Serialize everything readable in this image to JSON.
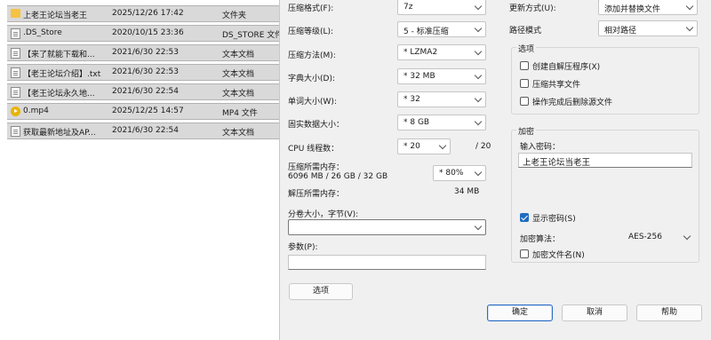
{
  "files": [
    {
      "icon": "folder-icon",
      "name": "上老王论坛当老王",
      "date": "2025/12/26 17:42",
      "type": "文件夹"
    },
    {
      "icon": "file-icon",
      "name": ".DS_Store",
      "date": "2020/10/15 23:36",
      "type": "DS_STORE 文件"
    },
    {
      "icon": "text-file-icon",
      "name": "【来了就能下载和...",
      "date": "2021/6/30 22:53",
      "type": "文本文档"
    },
    {
      "icon": "text-file-icon",
      "name": "【老王论坛介绍】.txt",
      "date": "2021/6/30 22:53",
      "type": "文本文档"
    },
    {
      "icon": "text-file-icon",
      "name": "【老王论坛永久地...",
      "date": "2021/6/30 22:54",
      "type": "文本文档"
    },
    {
      "icon": "media-file-icon",
      "name": "0.mp4",
      "date": "2025/12/25 14:57",
      "type": "MP4 文件"
    },
    {
      "icon": "text-file-icon",
      "name": "获取最新地址及AP...",
      "date": "2021/6/30 22:54",
      "type": "文本文档"
    }
  ],
  "left": {
    "format_label": "压缩格式(F):",
    "format_value": "7z",
    "level_label": "压缩等级(L):",
    "level_value": "5 - 标准压缩",
    "method_label": "压缩方法(M):",
    "method_value": "* LZMA2",
    "dict_label": "字典大小(D):",
    "dict_value": "* 32 MB",
    "word_label": "单词大小(W):",
    "word_value": "* 32",
    "solid_label": "固实数据大小：",
    "solid_value": "* 8 GB",
    "cpu_label": "CPU 线程数：",
    "cpu_value": "* 20",
    "cpu_max": "/ 20",
    "mem_label": "压缩所需内存：",
    "mem_detail": "6096 MB / 26 GB / 32 GB",
    "mem_percent": "* 80%",
    "decomp_label": "解压所需内存：",
    "decomp_value": "34 MB",
    "split_label": "分卷大小，字节(V):",
    "split_value": "",
    "params_label": "参数(P):",
    "params_value": "",
    "options_button": "选项"
  },
  "right": {
    "update_label": "更新方式(U):",
    "update_value": "添加并替换文件",
    "path_label": "路径模式",
    "path_value": "相对路径",
    "options_group": "选项",
    "opt_sfx": "创建自解压程序(X)",
    "opt_sfx_checked": false,
    "opt_shared": "压缩共享文件",
    "opt_shared_checked": false,
    "opt_delete": "操作完成后删除源文件",
    "opt_delete_checked": false,
    "encrypt_group": "加密",
    "password_label": "输入密码：",
    "password_value": "上老王论坛当老王",
    "show_password": "显示密码(S)",
    "show_password_checked": true,
    "enc_method_label": "加密算法：",
    "enc_method_value": "AES-256",
    "enc_names": "加密文件名(N)",
    "enc_names_checked": false
  },
  "buttons": {
    "ok": "确定",
    "cancel": "取消",
    "help": "帮助"
  }
}
